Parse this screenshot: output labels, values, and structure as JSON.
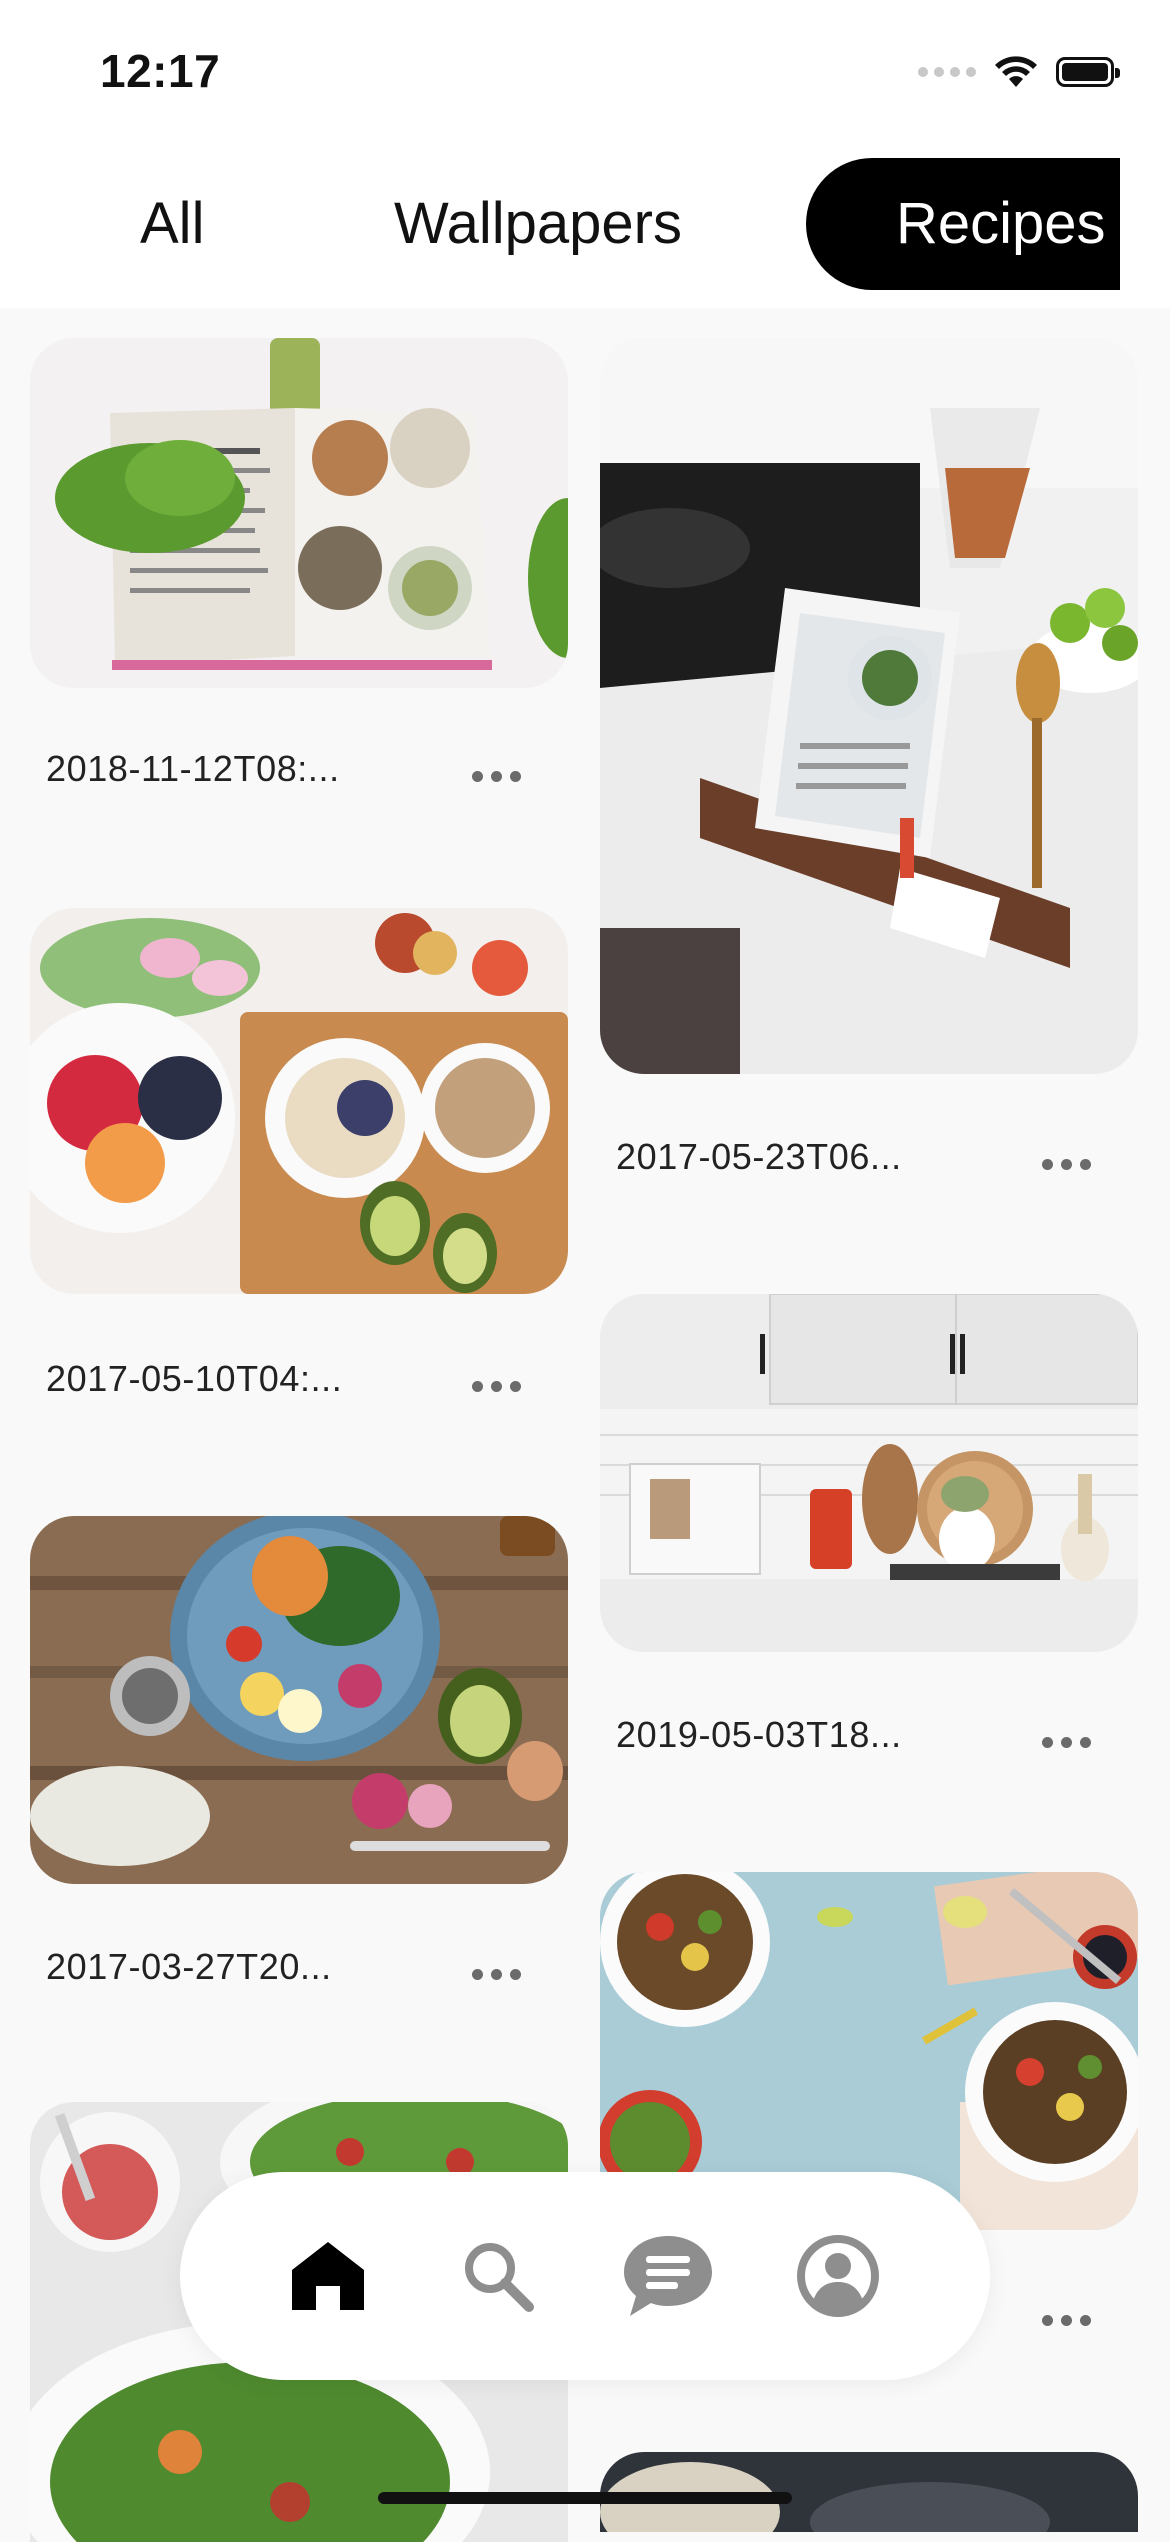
{
  "status_bar": {
    "time": "12:17"
  },
  "tabs": [
    {
      "label": "All",
      "selected": false
    },
    {
      "label": "Wallpapers",
      "selected": false
    },
    {
      "label": "Recipes",
      "selected": true
    }
  ],
  "cards": [
    {
      "caption": "2018-11-12T08:...",
      "image": "open cookbook with parsley"
    },
    {
      "caption": "2017-05-23T06...",
      "image": "tablet on kitchen counter with utensils"
    },
    {
      "caption": "2017-05-10T04:...",
      "image": "fruit plate, oatmeal bowl and avocado"
    },
    {
      "caption": "2019-05-03T18...",
      "image": "white kitchen shelf with cookbook stand"
    },
    {
      "caption": "2017-03-27T20...",
      "image": "salad bowl with egg and radish"
    },
    {
      "caption": "",
      "image": "salads on blue table"
    },
    {
      "caption": "",
      "image": "salad plate with dressing"
    },
    {
      "caption": "",
      "image": "dark food photo"
    }
  ],
  "bottom_nav": [
    {
      "icon": "home-icon",
      "active": true
    },
    {
      "icon": "search-icon",
      "active": false
    },
    {
      "icon": "chat-icon",
      "active": false
    },
    {
      "icon": "profile-icon",
      "active": false
    }
  ],
  "colors": {
    "accent": "#000000",
    "inactive_icon": "#8e8e8e",
    "background": "#f9f9f9"
  }
}
